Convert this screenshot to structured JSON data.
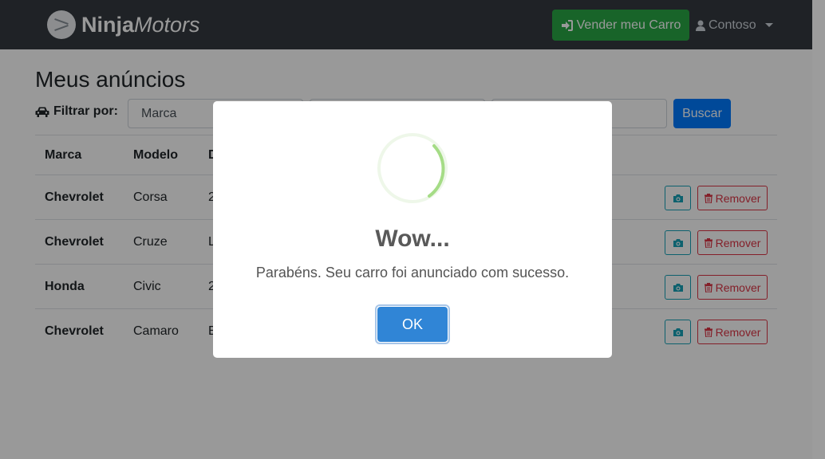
{
  "navbar": {
    "brand_bold": "Ninja",
    "brand_italic": "Motors",
    "sell_button": "Vender meu Carro",
    "user_name": "Contoso"
  },
  "page": {
    "title": "Meus anúncios",
    "filter_label": "Filtrar por:",
    "filter_placeholder": "Marca",
    "search_button": "Buscar"
  },
  "table": {
    "headers": [
      "Marca",
      "Modelo",
      "D"
    ],
    "rows": [
      {
        "marca": "Chevrolet",
        "modelo": "Corsa",
        "desc": "2"
      },
      {
        "marca": "Chevrolet",
        "modelo": "Cruze",
        "desc": "L"
      },
      {
        "marca": "Honda",
        "modelo": "Civic",
        "desc": "2"
      },
      {
        "marca": "Chevrolet",
        "modelo": "Camaro",
        "desc": "E"
      }
    ],
    "remove_label": "Remover"
  },
  "modal": {
    "title": "Wow...",
    "message": "Parabéns. Seu carro foi anunciado com sucesso.",
    "ok_button": "OK"
  },
  "colors": {
    "navbar": "#343a40",
    "success": "#28a745",
    "primary": "#007bff",
    "info": "#17a2b8",
    "danger": "#dc3545",
    "modal_ok": "#3085d6",
    "spinner": "#a5dc86"
  }
}
